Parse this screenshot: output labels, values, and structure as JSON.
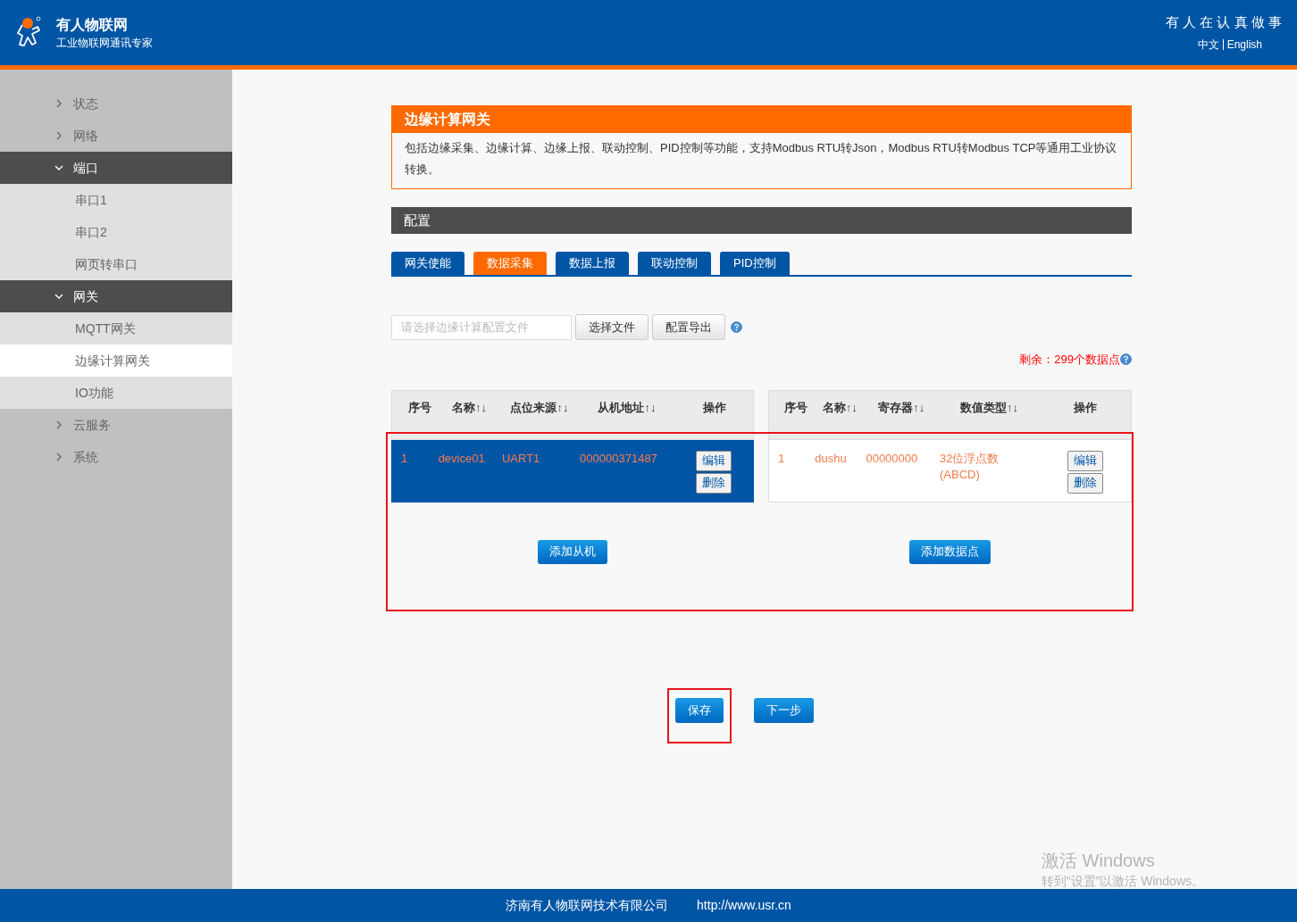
{
  "header": {
    "brand": "有人物联网",
    "tagline": "工业物联网通讯专家",
    "slogan": "有 人 在 认 真 做 事",
    "languages": [
      {
        "label": "中文"
      },
      {
        "label": "English"
      }
    ]
  },
  "sidebar": {
    "items": [
      {
        "label": "状态",
        "expanded": false
      },
      {
        "label": "网络",
        "expanded": false
      },
      {
        "label": "端口",
        "expanded": true,
        "children": [
          {
            "label": "串口1",
            "selected": false
          },
          {
            "label": "串口2",
            "selected": false
          },
          {
            "label": "网页转串口",
            "selected": false
          }
        ]
      },
      {
        "label": "网关",
        "expanded": true,
        "children": [
          {
            "label": "MQTT网关",
            "selected": false
          },
          {
            "label": "边缘计算网关",
            "selected": true
          },
          {
            "label": "IO功能",
            "selected": false
          }
        ]
      },
      {
        "label": "云服务",
        "expanded": false
      },
      {
        "label": "系统",
        "expanded": false
      }
    ]
  },
  "intro": {
    "title": "边缘计算网关",
    "text": "包括边缘采集、边缘计算、边缘上报、联动控制、PID控制等功能，支持Modbus RTU转Json，Modbus RTU转Modbus TCP等通用工业协议转换。"
  },
  "config": {
    "title": "配置",
    "tabs": [
      {
        "label": "网关使能",
        "selected": false
      },
      {
        "label": "数据采集",
        "selected": true
      },
      {
        "label": "数据上报",
        "selected": false
      },
      {
        "label": "联动控制",
        "selected": false
      },
      {
        "label": "PID控制",
        "selected": false
      }
    ],
    "file_field": {
      "placeholder": "请选择边缘计算配置文件"
    },
    "file_buttons": [
      "选择文件",
      "配置导出"
    ],
    "remaining": "剩余：299个数据点",
    "highlighted": true,
    "slaves": {
      "columns": [
        "序号",
        "名称↑↓",
        "点位来源↑↓",
        "从机地址↑↓",
        "操作"
      ],
      "rows": [
        {
          "cells": [
            "1",
            "device01",
            "UART1",
            "000000371487"
          ],
          "actions": [
            "编辑",
            "删除"
          ],
          "selected": true
        }
      ],
      "add_button": "添加从机"
    },
    "points": {
      "columns": [
        "序号",
        "名称↑↓",
        "寄存器↑↓",
        "数值类型↑↓",
        "操作"
      ],
      "rows": [
        {
          "cells": [
            "1",
            "dushu",
            "00000000",
            "32位浮点数(ABCD)"
          ],
          "actions": [
            "编辑",
            "删除"
          ],
          "selected": false
        }
      ],
      "add_button": "添加数据点"
    }
  },
  "actions": [
    {
      "label": "保存",
      "highlighted": true
    },
    {
      "label": "下一步",
      "highlighted": false
    }
  ],
  "activation": {
    "title": "激活 Windows",
    "text": "转到“设置”以激活 Windows。"
  },
  "footer": {
    "company": "济南有人物联网技术有限公司",
    "url": "http://www.usr.cn"
  }
}
